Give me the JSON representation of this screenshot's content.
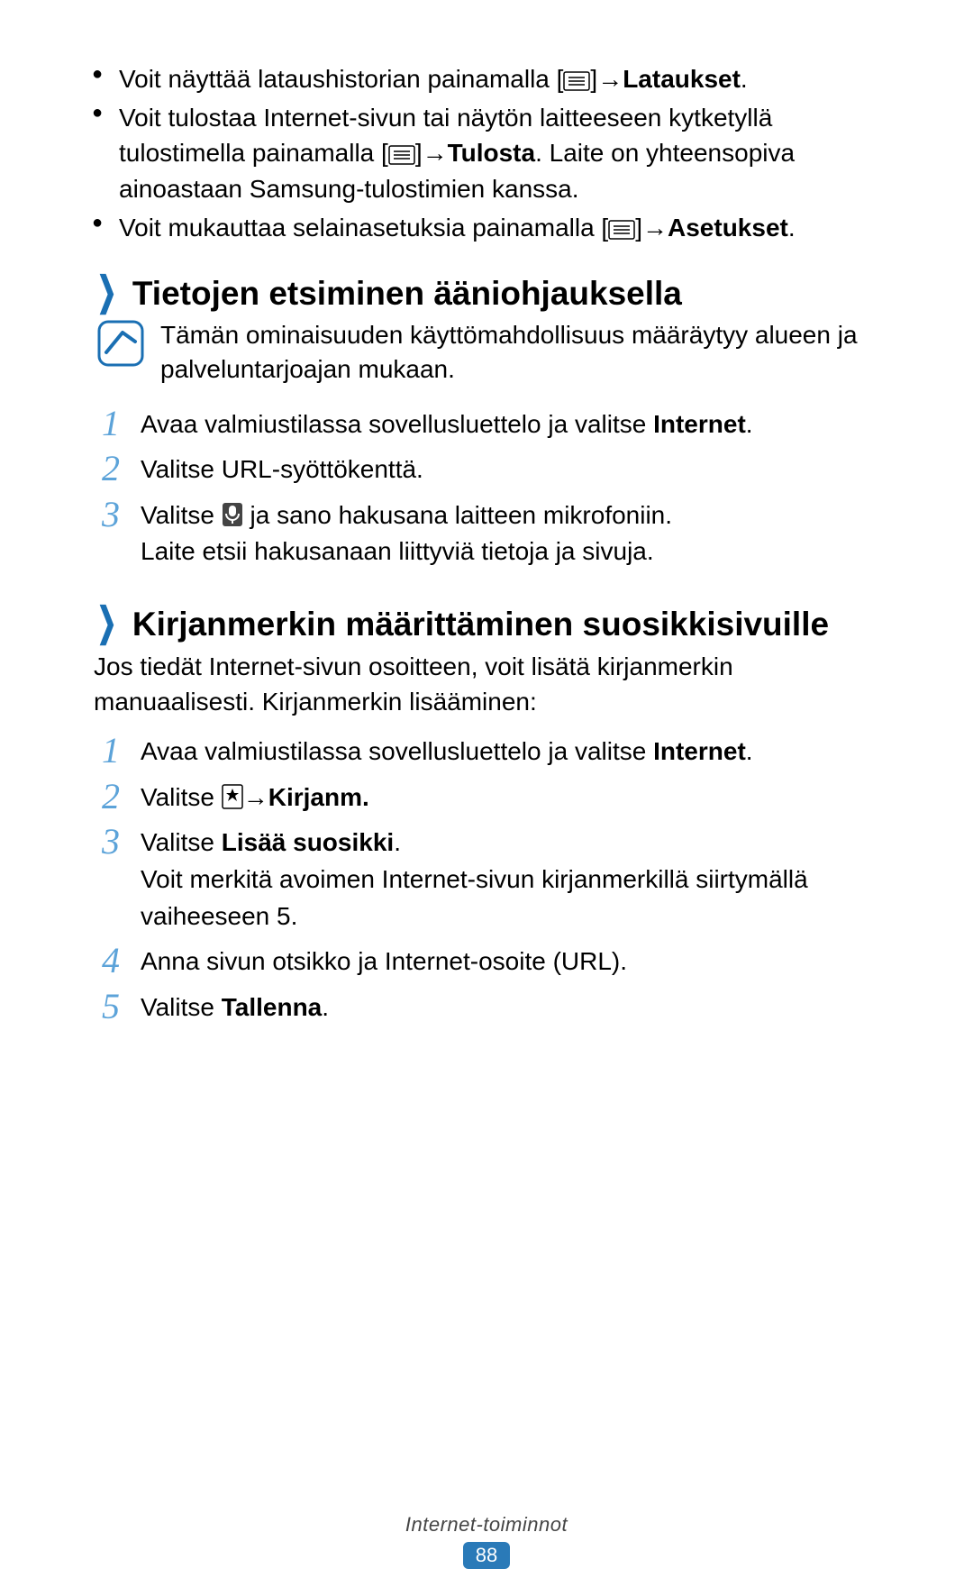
{
  "bullets": [
    {
      "pre": "Voit näyttää lataushistorian painamalla [",
      "arrow": " → ",
      "bold": "Lataukset",
      "post": "."
    },
    {
      "pre": "Voit tulostaa Internet-sivun tai näytön laitteeseen kytketyllä tulostimella painamalla [",
      "arrow": " → ",
      "bold": "Tulosta",
      "post": ". Laite on yhteensopiva ainoastaan Samsung-tulostimien kanssa."
    },
    {
      "pre": "Voit mukauttaa selainasetuksia painamalla [",
      "arrow": " → ",
      "bold": "Asetukset",
      "post": "."
    }
  ],
  "section1": {
    "title": "Tietojen etsiminen ääniohjauksella",
    "note": "Tämän ominaisuuden käyttömahdollisuus määräytyy alueen ja palveluntarjoajan mukaan.",
    "steps": [
      {
        "n": "1",
        "pre": "Avaa valmiustilassa sovellusluettelo ja valitse ",
        "bold": "Internet",
        "post": "."
      },
      {
        "n": "2",
        "text": "Valitse URL-syöttökenttä."
      },
      {
        "n": "3",
        "pre": "Valitse ",
        "mid": " ja sano hakusana laitteen mikrofoniin.",
        "line2": "Laite etsii hakusanaan liittyviä tietoja ja sivuja."
      }
    ]
  },
  "section2": {
    "title": "Kirjanmerkin määrittäminen suosikkisivuille",
    "intro": "Jos tiedät Internet-sivun osoitteen, voit lisätä kirjanmerkin manuaalisesti. Kirjanmerkin lisääminen:",
    "steps": [
      {
        "n": "1",
        "pre": "Avaa valmiustilassa sovellusluettelo ja valitse ",
        "bold": "Internet",
        "post": "."
      },
      {
        "n": "2",
        "pre": "Valitse ",
        "arrow": " → ",
        "bold": "Kirjanm."
      },
      {
        "n": "3",
        "pre": "Valitse ",
        "bold": "Lisää suosikki",
        "post": ".",
        "line2": "Voit merkitä avoimen Internet-sivun kirjanmerkillä siirtymällä vaiheeseen 5."
      },
      {
        "n": "4",
        "text": "Anna sivun otsikko ja Internet-osoite (URL)."
      },
      {
        "n": "5",
        "pre": "Valitse ",
        "bold": "Tallenna",
        "post": "."
      }
    ]
  },
  "footer": {
    "label": "Internet-toiminnot",
    "page": "88"
  }
}
